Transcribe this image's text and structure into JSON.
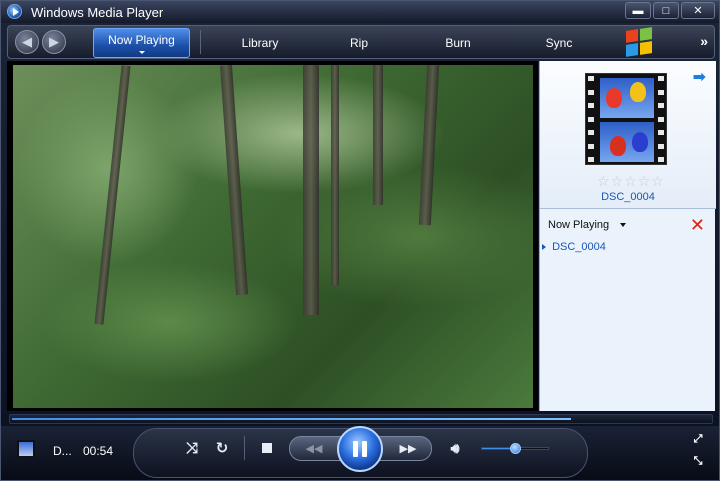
{
  "window": {
    "title": "Windows Media Player"
  },
  "title_buttons": {
    "minimize": "▬",
    "maximize": "□",
    "close": "✕"
  },
  "nav": {
    "back": "◀",
    "forward": "▶",
    "tabs": [
      "Now Playing",
      "Library",
      "Rip",
      "Burn",
      "Sync"
    ],
    "active_tab": "Now Playing",
    "more": "»"
  },
  "side_pane": {
    "media_name": "DSC_0004",
    "rating_stars": 0,
    "rating_max": 5,
    "playlist_label": "Now Playing",
    "playlist_items": [
      "DSC_0004"
    ]
  },
  "seek": {
    "progress": 0.89
  },
  "controls": {
    "now_title": "D...",
    "time": "00:54",
    "volume_level": 0.42
  },
  "colors": {
    "accent": "#2a6fe0",
    "link": "#1a56b8",
    "clear": "#dd2211",
    "win_logo": [
      "#e8431d",
      "#7cc242",
      "#2a9ae8",
      "#f5c000"
    ]
  }
}
